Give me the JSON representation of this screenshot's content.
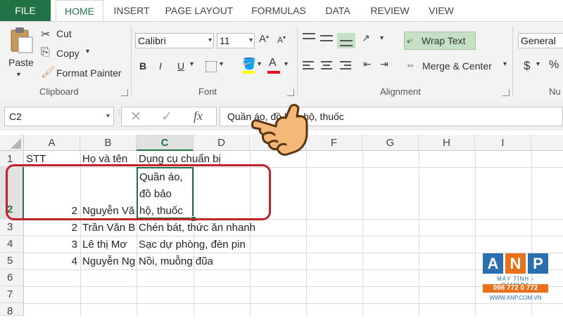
{
  "tabs": [
    "FILE",
    "HOME",
    "INSERT",
    "PAGE LAYOUT",
    "FORMULAS",
    "DATA",
    "REVIEW",
    "VIEW"
  ],
  "clipboard": {
    "paste": "Paste",
    "cut": "Cut",
    "copy": "Copy",
    "format_painter": "Format Painter",
    "label": "Clipboard"
  },
  "font": {
    "name": "Calibri",
    "size": "11",
    "bold": "B",
    "italic": "I",
    "underline": "U",
    "label": "Font",
    "font_color": "#e81123",
    "highlight_color": "#ffff00"
  },
  "alignment": {
    "wrap_text": "Wrap Text",
    "merge_center": "Merge & Center",
    "label": "Alignment"
  },
  "number": {
    "format": "General",
    "currency": "$",
    "percent": "%",
    "label": "Nu"
  },
  "formula_bar": {
    "name_box": "C2",
    "cancel": "✕",
    "enter": "✓",
    "fx": "fx",
    "value": "Quần áo, đồ bảo hộ, thuốc"
  },
  "columns": [
    "A",
    "B",
    "C",
    "D",
    "E",
    "F",
    "G",
    "H",
    "I"
  ],
  "rows": [
    "1",
    "2",
    "3",
    "4",
    "5",
    "6",
    "7",
    "8"
  ],
  "cells": {
    "r1": {
      "a": "STT",
      "b": "Họ và tên",
      "c": "Dụng cụ chuẩn bị"
    },
    "r2": {
      "a": "2",
      "b": "Nguyễn Vă",
      "c1": "Quần áo,",
      "c2": "đồ bảo",
      "c3": "hộ, thuốc"
    },
    "r3": {
      "a": "2",
      "b": "Trần Văn B",
      "c": "Chén bát, thức ăn nhanh"
    },
    "r4": {
      "a": "3",
      "b": "Lê thị Mơ",
      "c": "Sạc dự phòng, đèn pin"
    },
    "r5": {
      "a": "4",
      "b": "Nguyễn Ng",
      "c": "Nồi, muỗng đũa"
    }
  },
  "logo": {
    "letters": [
      "A",
      "N",
      "P"
    ],
    "tagline": "MÁY TÍNH - CAMERA",
    "phone": "098 772 0 772",
    "site": "WWW.ANP.COM.VN"
  },
  "colors": {
    "excel_green": "#217346",
    "highlight_red": "#c0212a",
    "logo_blue": "#2a6fb0",
    "logo_orange": "#e9711c"
  }
}
